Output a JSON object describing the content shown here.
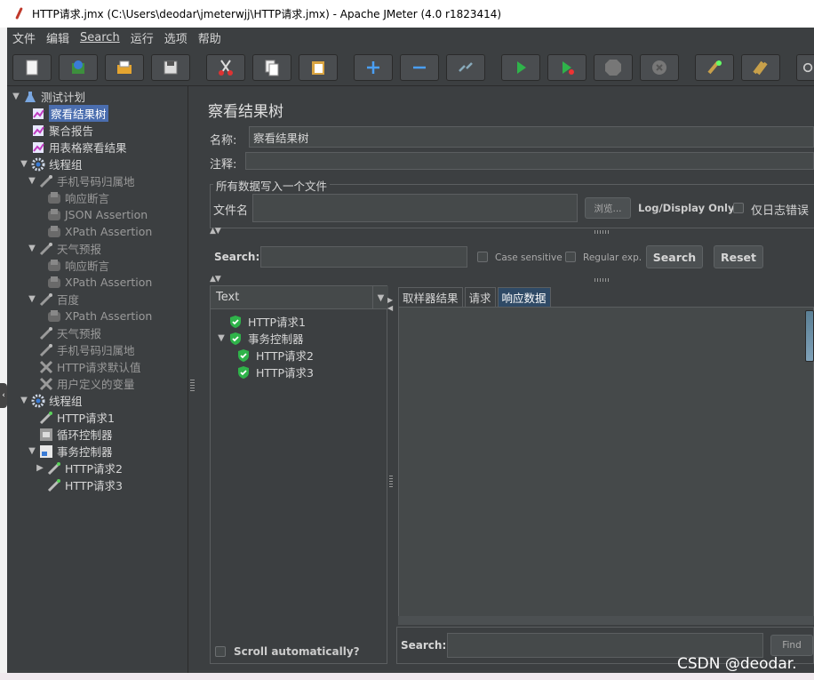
{
  "window": {
    "title": "HTTP请求.jmx (C:\\Users\\deodar\\jmeterwjj\\HTTP请求.jmx) - Apache JMeter (4.0 r1823414)"
  },
  "menu": {
    "items": [
      "文件",
      "编辑",
      "Search",
      "运行",
      "选项",
      "帮助"
    ]
  },
  "toolbar": {
    "buttons": [
      "new-icon",
      "templates-icon",
      "open-icon",
      "save-icon",
      "cut-icon",
      "copy-icon",
      "paste-icon",
      "expand-icon",
      "collapse-icon",
      "toggle-icon",
      "start-icon",
      "start-no-pause-icon",
      "stop-icon",
      "shutdown-icon",
      "clear-icon",
      "clear-all-icon",
      "search-icon"
    ]
  },
  "tree": {
    "items": [
      {
        "label": "测试计划",
        "depth": 0,
        "toggle": "▼",
        "icon": "flask-icon",
        "dim": false
      },
      {
        "label": "察看结果树",
        "depth": 1,
        "toggle": "",
        "icon": "chart-icon",
        "dim": false,
        "selected": true
      },
      {
        "label": "聚合报告",
        "depth": 1,
        "toggle": "",
        "icon": "chart-icon",
        "dim": false
      },
      {
        "label": "用表格察看结果",
        "depth": 1,
        "toggle": "",
        "icon": "chart-icon",
        "dim": false
      },
      {
        "label": "线程组",
        "depth": 1,
        "toggle": "▼",
        "icon": "gear-icon",
        "dim": false
      },
      {
        "label": "手机号码归属地",
        "depth": 2,
        "toggle": "▼",
        "icon": "pipette-icon",
        "dim": true
      },
      {
        "label": "响应断言",
        "depth": 3,
        "toggle": "",
        "icon": "assertion-icon",
        "dim": true
      },
      {
        "label": "JSON Assertion",
        "depth": 3,
        "toggle": "",
        "icon": "assertion-icon",
        "dim": true
      },
      {
        "label": "XPath Assertion",
        "depth": 3,
        "toggle": "",
        "icon": "assertion-icon",
        "dim": true
      },
      {
        "label": "天气预报",
        "depth": 2,
        "toggle": "▼",
        "icon": "pipette-icon",
        "dim": true
      },
      {
        "label": "响应断言",
        "depth": 3,
        "toggle": "",
        "icon": "assertion-icon",
        "dim": true
      },
      {
        "label": "XPath Assertion",
        "depth": 3,
        "toggle": "",
        "icon": "assertion-icon",
        "dim": true
      },
      {
        "label": "百度",
        "depth": 2,
        "toggle": "▼",
        "icon": "pipette-icon",
        "dim": true
      },
      {
        "label": "XPath Assertion",
        "depth": 3,
        "toggle": "",
        "icon": "assertion-icon",
        "dim": true
      },
      {
        "label": "天气预报",
        "depth": 2,
        "toggle": "",
        "icon": "pipette-icon",
        "dim": true
      },
      {
        "label": "手机号码归属地",
        "depth": 2,
        "toggle": "",
        "icon": "pipette-icon",
        "dim": true
      },
      {
        "label": "HTTP请求默认值",
        "depth": 2,
        "toggle": "",
        "icon": "wrench-icon",
        "dim": true
      },
      {
        "label": "用户定义的变量",
        "depth": 2,
        "toggle": "",
        "icon": "wrench-icon",
        "dim": true
      },
      {
        "label": "线程组",
        "depth": 1,
        "toggle": "▼",
        "icon": "gear-icon",
        "dim": false
      },
      {
        "label": "HTTP请求1",
        "depth": 2,
        "toggle": "",
        "icon": "pipette-green-icon",
        "dim": false
      },
      {
        "label": "循环控制器",
        "depth": 2,
        "toggle": "",
        "icon": "loop-icon",
        "dim": false
      },
      {
        "label": "事务控制器",
        "depth": 2,
        "toggle": "▼",
        "icon": "transaction-icon",
        "dim": false
      },
      {
        "label": "HTTP请求2",
        "depth": 3,
        "toggle": "▶",
        "icon": "pipette-green-icon",
        "dim": false
      },
      {
        "label": "HTTP请求3",
        "depth": 3,
        "toggle": "",
        "icon": "pipette-green-icon",
        "dim": false
      }
    ]
  },
  "panel": {
    "title": "察看结果树",
    "name_label": "名称:",
    "name_value": "察看结果树",
    "comment_label": "注释:",
    "comment_value": "",
    "file_group_title": "所有数据写入一个文件",
    "file_label": "文件名",
    "file_value": "",
    "browse_label": "浏览...",
    "logdisplay_label": "Log/Display Only:",
    "errors_only_label": "仅日志错误",
    "search_label": "Search:",
    "search_value": "",
    "case_sensitive_label": "Case sensitive",
    "regex_label": "Regular exp.",
    "search_button": "Search",
    "reset_button": "Reset",
    "renderer": "Text",
    "tabs": [
      "取样器结果",
      "请求",
      "响应数据"
    ],
    "active_tab": 2,
    "scroll_label": "Scroll automatically?",
    "find_search_label": "Search:",
    "find_value": "",
    "find_button": "Find"
  },
  "results": {
    "items": [
      {
        "label": "HTTP请求1",
        "depth": 0,
        "toggle": ""
      },
      {
        "label": "事务控制器",
        "depth": 0,
        "toggle": "▼"
      },
      {
        "label": "HTTP请求2",
        "depth": 1,
        "toggle": ""
      },
      {
        "label": "HTTP请求3",
        "depth": 1,
        "toggle": ""
      }
    ]
  },
  "watermark": "CSDN @deodar.",
  "colors": {
    "pass": "#2fb34a",
    "selection": "#4b6eaf",
    "background": "#3c3f41"
  }
}
